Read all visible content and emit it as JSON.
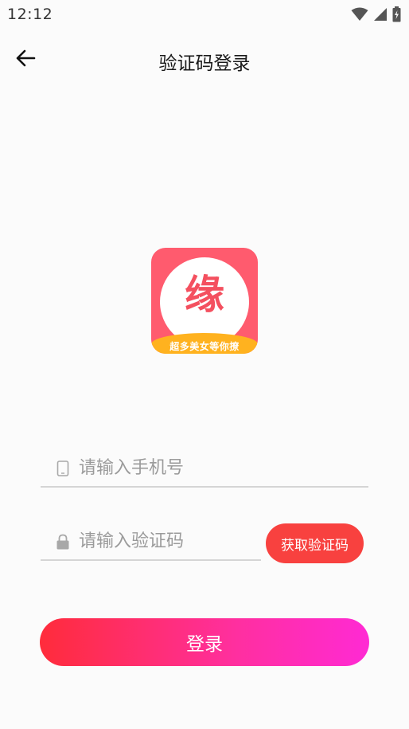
{
  "status_bar": {
    "time": "12:12",
    "icons": [
      "wifi-icon",
      "signal-icon",
      "battery-icon"
    ]
  },
  "header": {
    "back_icon": "arrow-left-icon",
    "title": "验证码登录"
  },
  "logo": {
    "character": "缘",
    "banner_text": "超多美女等你撩",
    "colors": {
      "background": "#ff5b6e",
      "banner": "#ffb21f",
      "character": "#f4505f"
    }
  },
  "form": {
    "phone": {
      "placeholder": "请输入手机号",
      "value": "",
      "icon": "phone-icon"
    },
    "code": {
      "placeholder": "请输入验证码",
      "value": "",
      "icon": "lock-icon"
    },
    "get_code_label": "获取验证码",
    "login_label": "登录"
  },
  "colors": {
    "accent_red": "#f8413f",
    "gradient_start": "#ff2c3b",
    "gradient_end": "#ff2ad4"
  }
}
